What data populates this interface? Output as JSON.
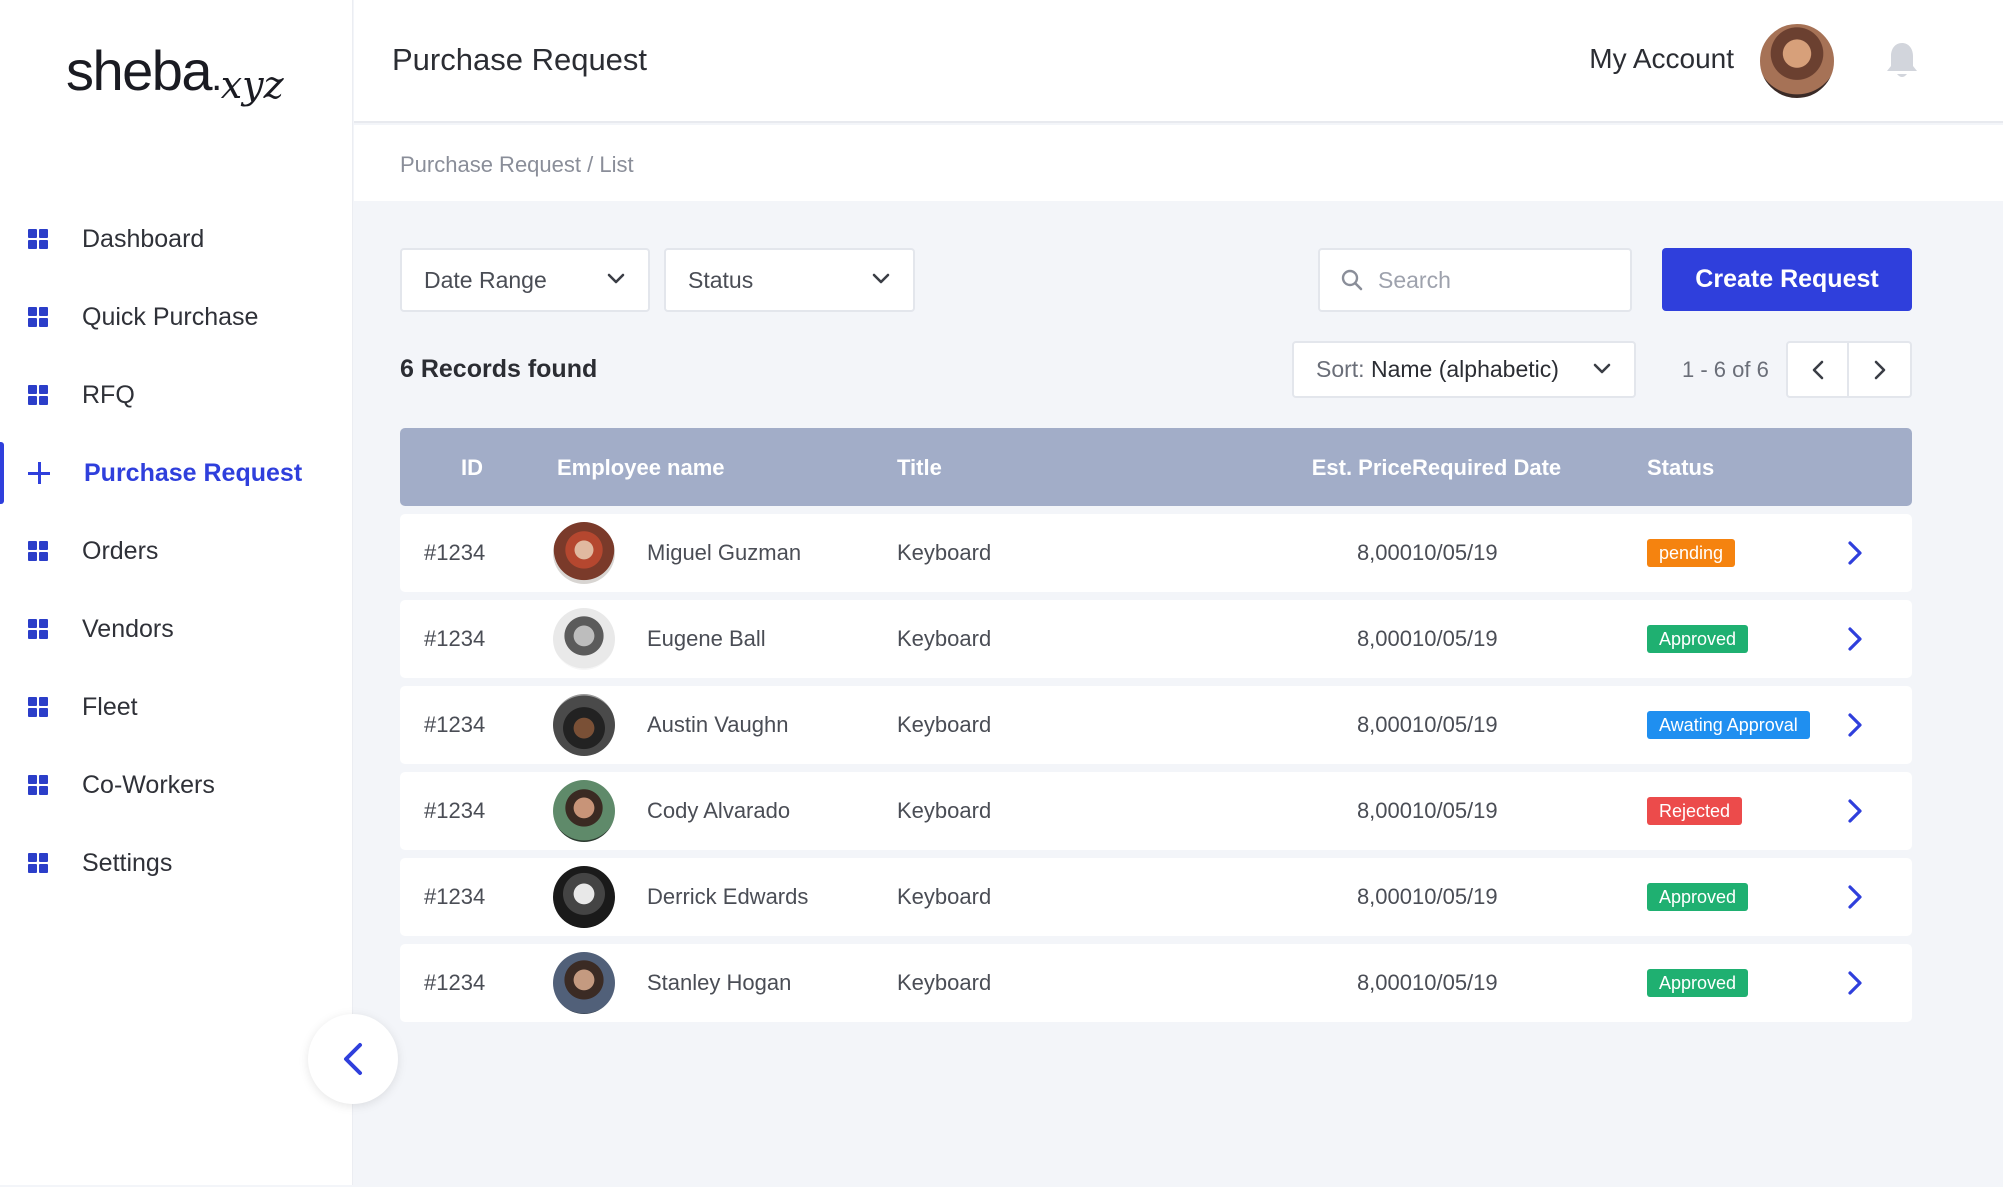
{
  "brand": {
    "logo_main": "sheba",
    "logo_dot": ".",
    "logo_suffix": "xyz"
  },
  "sidebar": {
    "items": [
      {
        "label": "Dashboard",
        "icon": "grid-icon",
        "active": false
      },
      {
        "label": "Quick Purchase",
        "icon": "grid-icon",
        "active": false
      },
      {
        "label": "RFQ",
        "icon": "grid-icon",
        "active": false
      },
      {
        "label": "Purchase Request",
        "icon": "plus-icon",
        "active": true
      },
      {
        "label": "Orders",
        "icon": "grid-icon",
        "active": false
      },
      {
        "label": "Vendors",
        "icon": "grid-icon",
        "active": false
      },
      {
        "label": "Fleet",
        "icon": "grid-icon",
        "active": false
      },
      {
        "label": "Co-Workers",
        "icon": "grid-icon",
        "active": false
      },
      {
        "label": "Settings",
        "icon": "grid-icon",
        "active": false
      }
    ],
    "collapse_icon": "chevron-left-icon"
  },
  "header": {
    "title": "Purchase Request",
    "account_label": "My Account",
    "notification_icon": "bell-icon"
  },
  "breadcrumb": "Purchase Request / List",
  "filters": {
    "date_range": "Date Range",
    "status": "Status",
    "search_placeholder": "Search",
    "create_button": "Create Request"
  },
  "list": {
    "records_found": "6 Records found",
    "sort_label": "Sort: ",
    "sort_value": "Name (alphabetic)",
    "pagination": "1 - 6 of 6"
  },
  "table": {
    "columns": [
      "ID",
      "Employee name",
      "Title",
      "Est. Price",
      "Required Date",
      "Status"
    ],
    "rows": [
      {
        "id": "#1234",
        "name": "Miguel Guzman",
        "title": "Keyboard",
        "price": "8,000",
        "date": "10/05/19",
        "status": "pending"
      },
      {
        "id": "#1234",
        "name": "Eugene Ball",
        "title": "Keyboard",
        "price": "8,000",
        "date": "10/05/19",
        "status": "Approved"
      },
      {
        "id": "#1234",
        "name": "Austin Vaughn",
        "title": "Keyboard",
        "price": "8,000",
        "date": "10/05/19",
        "status": "Awating Approval"
      },
      {
        "id": "#1234",
        "name": "Cody Alvarado",
        "title": "Keyboard",
        "price": "8,000",
        "date": "10/05/19",
        "status": "Rejected"
      },
      {
        "id": "#1234",
        "name": "Derrick Edwards",
        "title": "Keyboard",
        "price": "8,000",
        "date": "10/05/19",
        "status": "Approved"
      },
      {
        "id": "#1234",
        "name": "Stanley Hogan",
        "title": "Keyboard",
        "price": "8,000",
        "date": "10/05/19",
        "status": "Approved"
      }
    ]
  },
  "colors": {
    "accent": "#2f3fdc",
    "table_header": "#a2adc8",
    "status_pending": "#f5830f",
    "status_approved": "#1fb071",
    "status_awaiting": "#1f8ff0",
    "status_rejected": "#ec4b4b"
  }
}
